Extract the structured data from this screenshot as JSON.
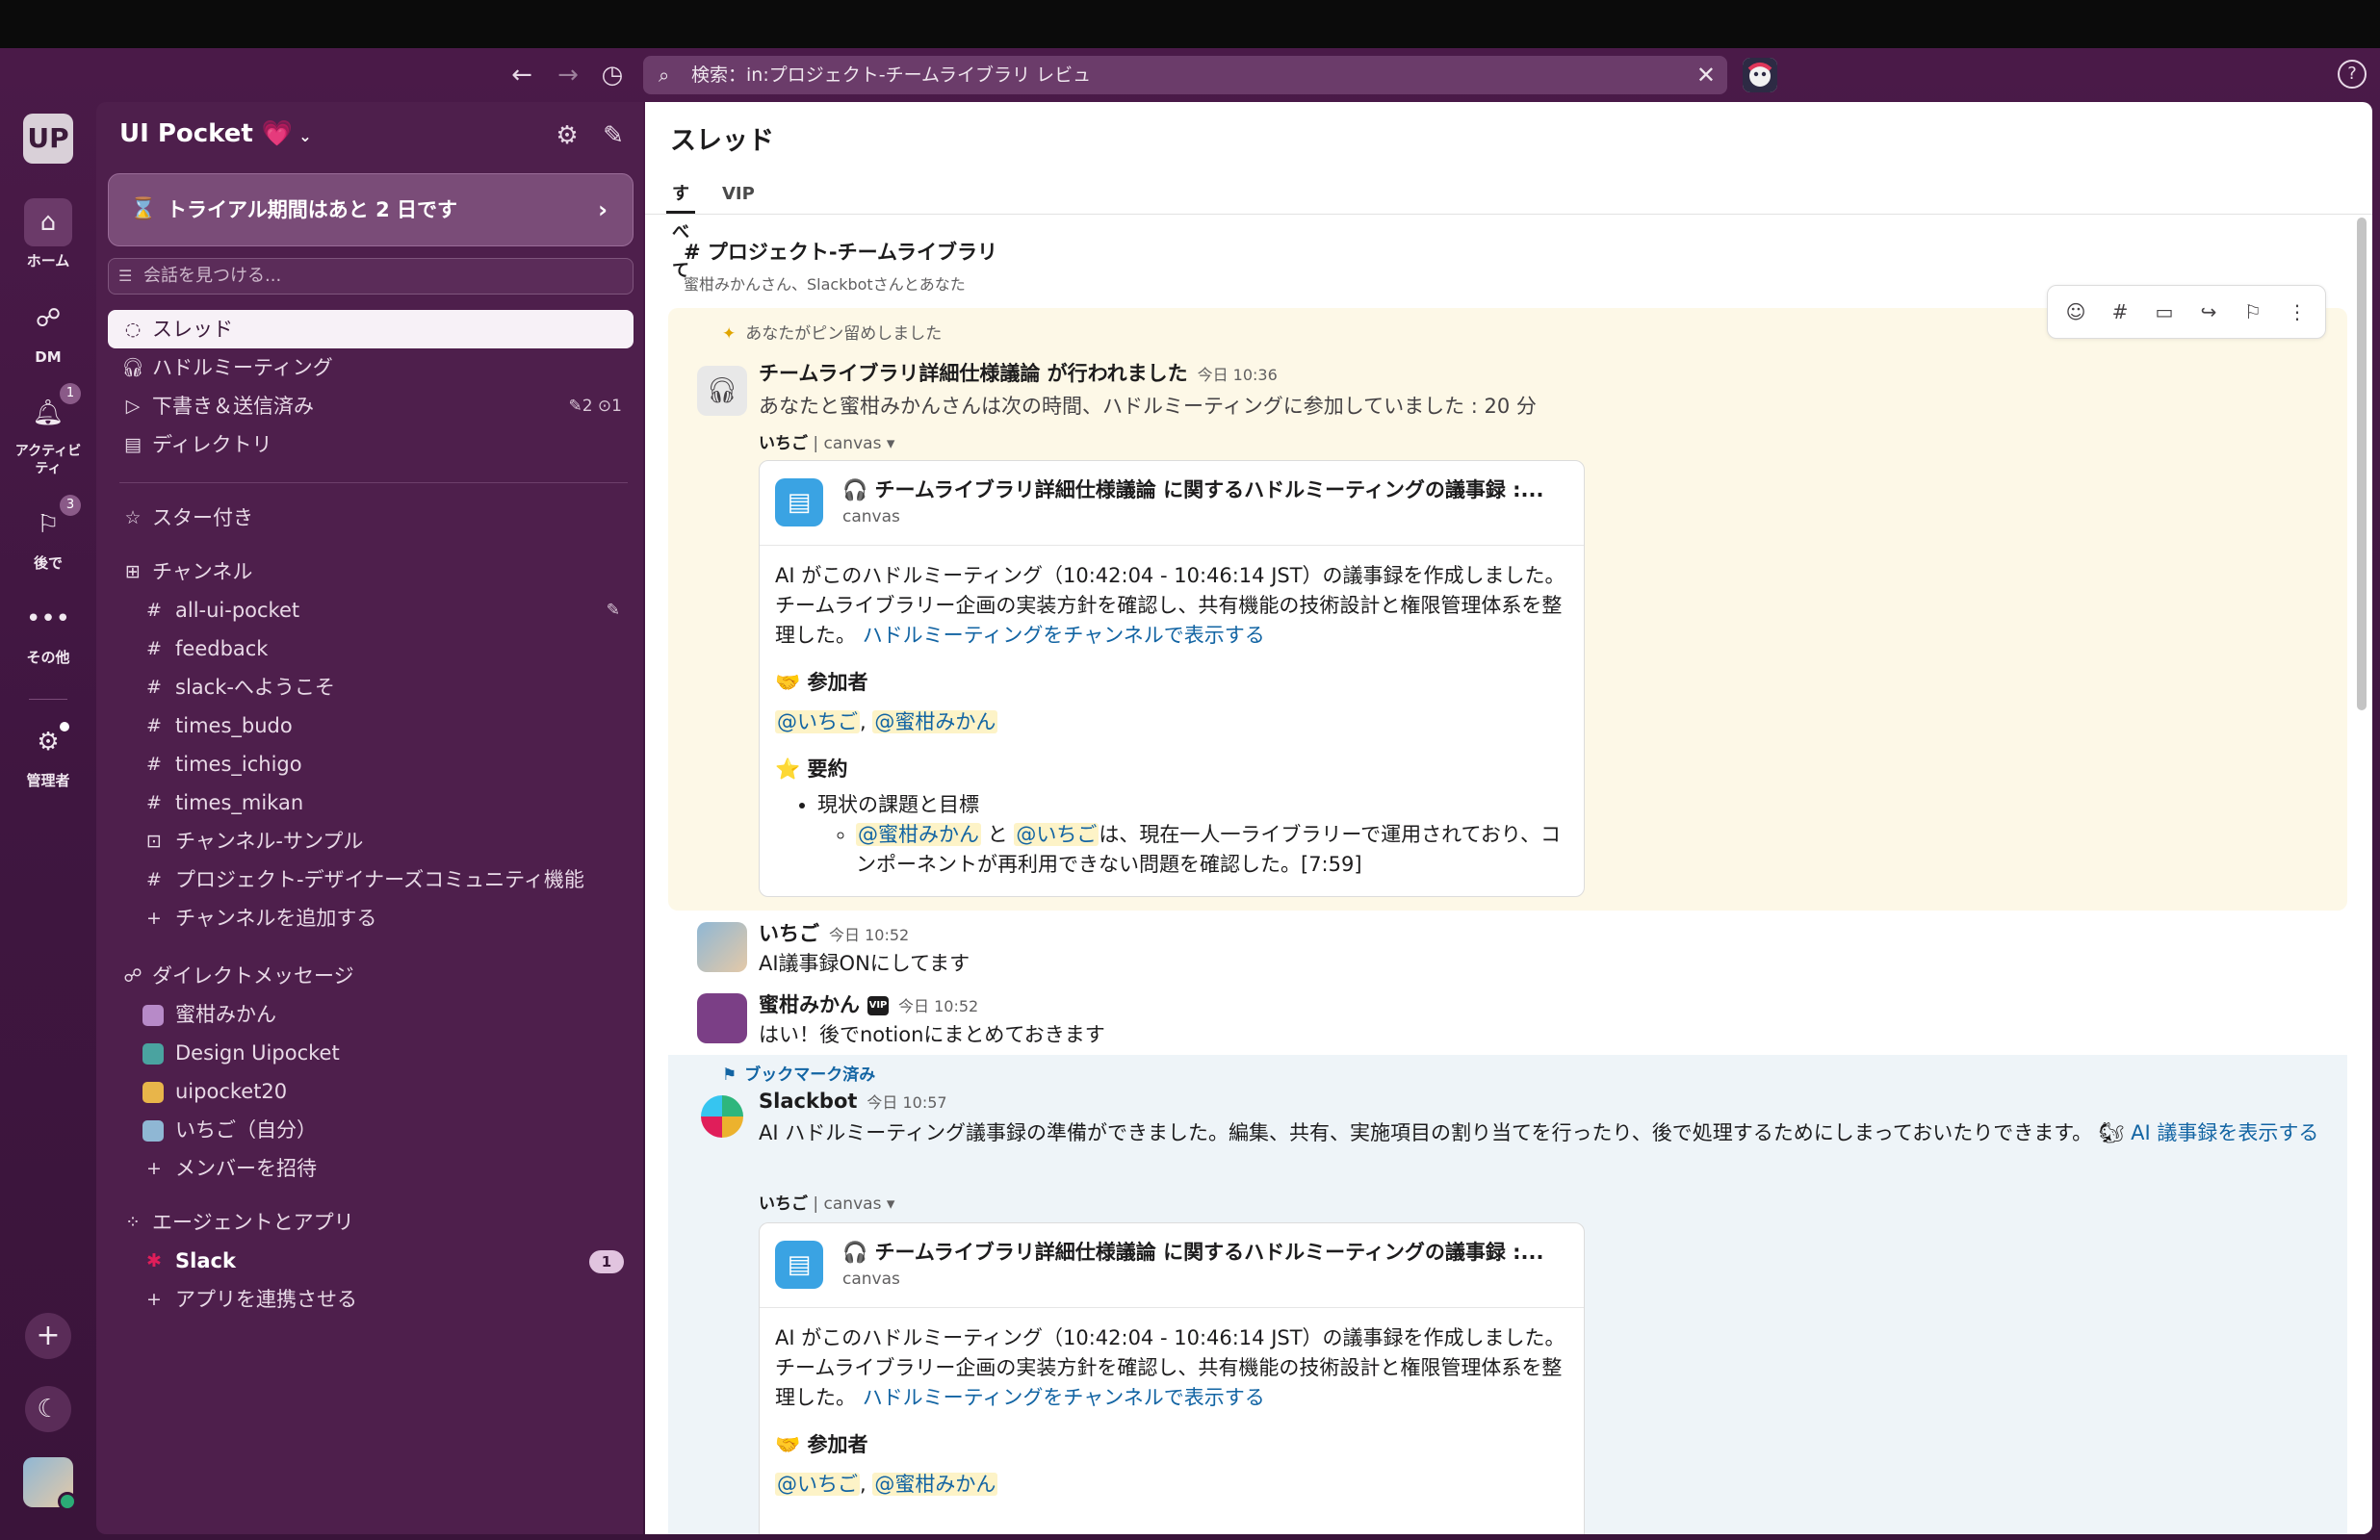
{
  "search": {
    "query": "検索：in:プロジェクト-チームライブラリ レビュ"
  },
  "rail": {
    "workspace_initials": "UP",
    "items": [
      {
        "label": "ホーム",
        "icon": "home-icon"
      },
      {
        "label": "DM",
        "icon": "dm-icon"
      },
      {
        "label": "アクティビティ",
        "icon": "bell-icon",
        "badge": "1"
      },
      {
        "label": "後で",
        "icon": "bookmark-icon",
        "badge": "3"
      },
      {
        "label": "その他",
        "icon": "more-icon"
      },
      {
        "label": "管理者",
        "icon": "gear-icon"
      }
    ]
  },
  "sidebar": {
    "workspace_name": "UI Pocket 💗",
    "trial_banner": "トライアル期間はあと 2 日です",
    "find_placeholder": "会話を見つける...",
    "nav": [
      {
        "label": "スレッド"
      },
      {
        "label": "ハドルミーティング"
      },
      {
        "label": "下書き＆送信済み",
        "meta": "✎2  ⊙1"
      },
      {
        "label": "ディレクトリ"
      }
    ],
    "starred": "スター付き",
    "channels_header": "チャンネル",
    "channels": [
      "all-ui-pocket",
      "feedback",
      "slack-へようこそ",
      "times_budo",
      "times_ichigo",
      "times_mikan",
      "チャンネル-サンプル",
      "プロジェクト-デザイナーズコミュニティ機能"
    ],
    "add_channel": "チャンネルを追加する",
    "dm_header": "ダイレクトメッセージ",
    "dms": [
      "蜜柑みかん",
      "Design Uipocket",
      "uipocket20",
      "いちご（自分）"
    ],
    "invite": "メンバーを招待",
    "apps_header": "エージェントとアプリ",
    "apps": [
      {
        "name": "Slack",
        "badge": "1"
      }
    ],
    "connect_app": "アプリを連携させる"
  },
  "main": {
    "title": "スレッド",
    "tabs": [
      "すべて",
      "VIP"
    ],
    "channel": "# プロジェクト-チームライブラリ",
    "members": "蜜柑みかんさん、Slackbotさんとあなた",
    "pinned_note": "あなたがピン留めしました",
    "huddle": {
      "title": "チームライブラリ詳細仕様議論 が行われました",
      "time": "今日 10:36",
      "text": "あなたと蜜柑みかんさんは次の時間、ハドルミーティングに参加していました : 20 分",
      "source_user": "いちご",
      "source_type": "canvas"
    },
    "canvas": {
      "title": "🎧 チームライブラリ詳細仕様議論 に関するハドルミーティングの議事録 :...",
      "subtitle": "canvas",
      "intro": "AI がこのハドルミーティング（10:42:04 - 10:46:14 JST）の議事録を作成しました。チームライブラリー企画の実装方針を確認し、共有機能の技術設計と権限管理体系を整理した。",
      "link": "ハドルミーティングをチャンネルで表示する",
      "participants_h": "🤝 参加者",
      "participant_1": "@いちご",
      "participant_2": "@蜜柑みかん",
      "summary_h": "⭐ 要約",
      "bullet": "現状の課題と目標",
      "sub_m1": "@蜜柑みかん",
      "sub_and": " と ",
      "sub_m2": "@いちご",
      "sub_text": "は、現在一人一ライブラリーで運用されており、コンポーネントが再利用できない問題を確認した。[7:59]"
    },
    "messages": [
      {
        "sender": "いちご",
        "time": "今日 10:52",
        "text": "AI議事録ONにしてます"
      },
      {
        "sender": "蜜柑みかん",
        "vip": "VIP",
        "time": "今日 10:52",
        "text": "はい！後でnotionにまとめておきます"
      }
    ],
    "bookmark_note": "ブックマーク済み",
    "slackbot": {
      "sender": "Slackbot",
      "time": "今日 10:57",
      "text": "AI ハドルミーティング議事録の準備ができました。編集、共有、実施項目の割り当てを行ったり、後で処理するためにしまっておいたりできます。",
      "link": "AI 議事録を表示する",
      "source_user": "いちご",
      "source_type": "canvas"
    }
  }
}
